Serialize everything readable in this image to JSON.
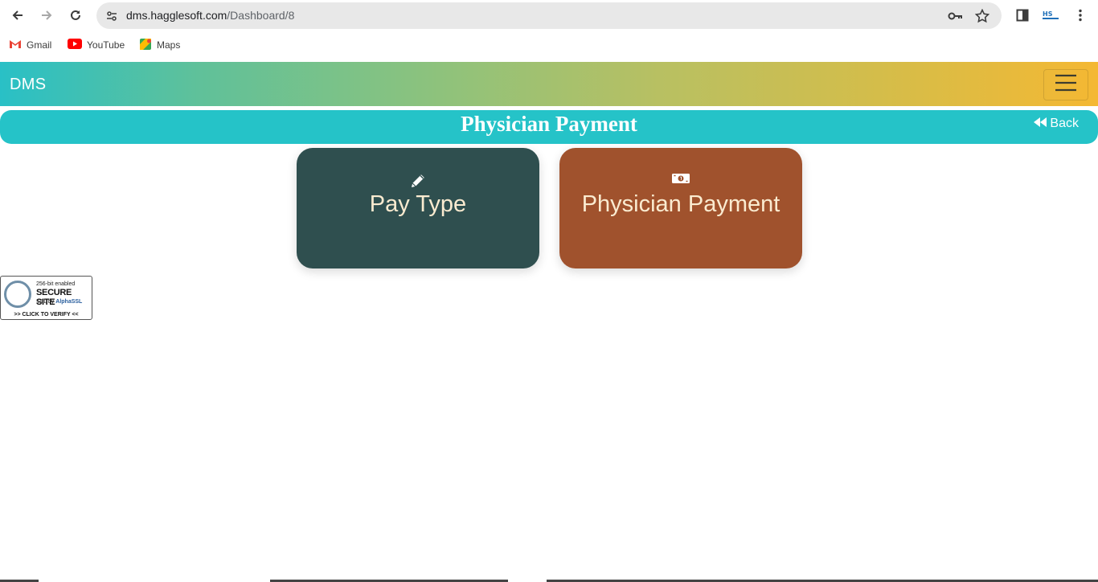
{
  "browser": {
    "url_host": "dms.hagglesoft.com",
    "url_path": "/Dashboard/8",
    "bookmarks": [
      {
        "label": "Gmail",
        "icon": "gmail-icon"
      },
      {
        "label": "YouTube",
        "icon": "youtube-icon"
      },
      {
        "label": "Maps",
        "icon": "maps-icon"
      }
    ],
    "icons": [
      "back-arrow-icon",
      "forward-arrow-icon",
      "reload-icon",
      "site-info-icon",
      "key-icon",
      "star-icon",
      "side-panel-icon",
      "profile-icon",
      "kebab-menu-icon"
    ]
  },
  "header": {
    "brand": "DMS",
    "menu_icon": "hamburger-icon"
  },
  "title_bar": {
    "title": "Physician Payment",
    "back_label": "Back",
    "back_icon": "double-chevron-left-icon"
  },
  "cards": [
    {
      "label": "Pay Type",
      "icon": "pencil-icon",
      "color": "#2f4f4f"
    },
    {
      "label": "Physician Payment",
      "icon": "money-bill-icon",
      "color": "#a0522d"
    }
  ],
  "colors": {
    "title_bar": "#25c3c8",
    "card_text": "#faebd0",
    "header_gradient_start": "#29c0c6",
    "header_gradient_end": "#f4b833"
  },
  "ssl_seal": {
    "line1": "256-bit enabled",
    "line2": "SECURE SITE",
    "line3_prefix": "SSL by ",
    "line3_brand": "AlphaSSL",
    "line4": ">> CLICK TO VERIFY <<"
  }
}
